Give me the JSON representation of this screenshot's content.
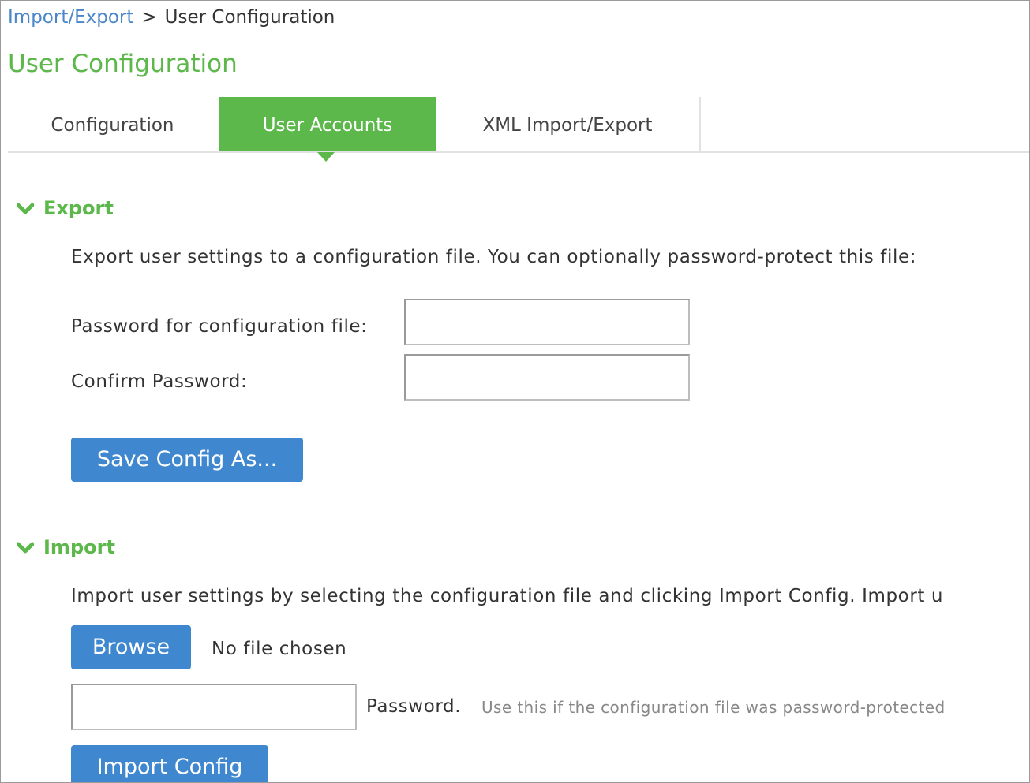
{
  "breadcrumb": {
    "parent": "Import/Export",
    "separator": ">",
    "current": "User Configuration"
  },
  "page_title": "User Configuration",
  "tabs": [
    {
      "label": "Configuration",
      "active": false
    },
    {
      "label": "User Accounts",
      "active": true
    },
    {
      "label": "XML Import/Export",
      "active": false
    }
  ],
  "export": {
    "heading": "Export",
    "description": "Export user settings to a configuration file. You can optionally password-protect this file:",
    "password_label": "Password for configuration file:",
    "password_value": "",
    "confirm_label": "Confirm Password:",
    "confirm_value": "",
    "save_button": "Save Config As..."
  },
  "import": {
    "heading": "Import",
    "description": "Import user settings by selecting the configuration file and clicking Import Config. Import u",
    "browse_button": "Browse",
    "file_status": "No file chosen",
    "password_value": "",
    "password_label": "Password.",
    "password_hint": "Use this if the configuration file was password-protected",
    "import_button": "Import Config"
  },
  "colors": {
    "accent_green": "#5cb84a",
    "button_blue": "#3f87cf",
    "link_blue": "#4a86c8"
  },
  "icons": {
    "section_toggle": "chevron-down-icon"
  }
}
